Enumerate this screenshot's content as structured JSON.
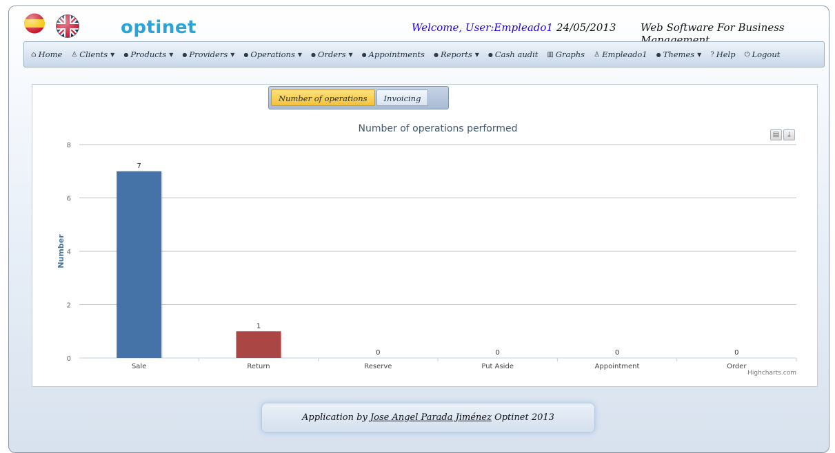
{
  "header": {
    "brand": "optinet",
    "welcome": "Welcome, User:Empleado1",
    "date": "24/05/2013",
    "tagline": "Web Software For Business Management."
  },
  "nav": [
    {
      "label": "Home",
      "icon": "home-icon",
      "caret": false
    },
    {
      "label": "Clients",
      "icon": "user-icon",
      "caret": true
    },
    {
      "label": "Products",
      "icon": "bullet-icon",
      "caret": true
    },
    {
      "label": "Providers",
      "icon": "bullet-icon",
      "caret": true
    },
    {
      "label": "Operations",
      "icon": "bullet-icon",
      "caret": true
    },
    {
      "label": "Orders",
      "icon": "bullet-icon",
      "caret": true
    },
    {
      "label": "Appointments",
      "icon": "bullet-icon",
      "caret": false
    },
    {
      "label": "Reports",
      "icon": "bullet-icon",
      "caret": true
    },
    {
      "label": "Cash audit",
      "icon": "bullet-icon",
      "caret": false
    },
    {
      "label": "Graphs",
      "icon": "bar-chart-icon",
      "caret": false
    },
    {
      "label": "Empleado1",
      "icon": "user-icon",
      "caret": false
    },
    {
      "label": "Themes",
      "icon": "bullet-icon",
      "caret": true
    },
    {
      "label": "Help",
      "icon": "question-icon",
      "caret": false
    },
    {
      "label": "Logout",
      "icon": "power-icon",
      "caret": false
    }
  ],
  "tabs": {
    "active": "Number of operations",
    "inactive": "Invoicing"
  },
  "chart_data": {
    "type": "bar",
    "title": "Number of operations performed",
    "ylabel": "Number",
    "xlabel": "",
    "categories": [
      "Sale",
      "Return",
      "Reserve",
      "Put Aside",
      "Appointment",
      "Order"
    ],
    "values": [
      7,
      1,
      0,
      0,
      0,
      0
    ],
    "colors": [
      "#4572a7",
      "#aa4643",
      "#89a54e",
      "#80699b",
      "#3d96ae",
      "#db843d"
    ],
    "ylim": [
      0,
      8
    ],
    "yticks": [
      0,
      2,
      4,
      6,
      8
    ],
    "grid": true,
    "data_labels": true,
    "credits": "Highcharts.com"
  },
  "footer": {
    "prefix": "Application by",
    "author": "Jose Angel Parada Jiménez",
    "suffix": "Optinet 2013"
  }
}
